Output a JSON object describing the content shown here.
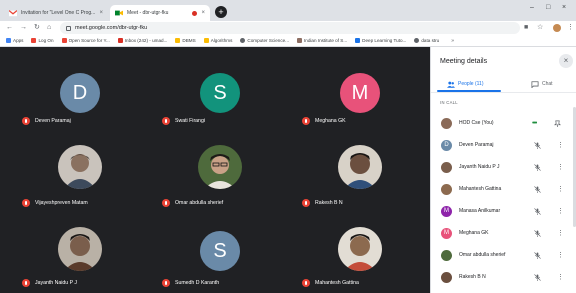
{
  "browser": {
    "tabs": [
      {
        "title": "Invitation for \"Level One C Prog...",
        "active": false,
        "favicon": "gmail-icon"
      },
      {
        "title": "Meet - dbr-utgr-fku",
        "active": true,
        "favicon": "meet-icon",
        "recording": true
      }
    ],
    "url": "meet.google.com/dbr-utgr-fku",
    "bookmarks": [
      {
        "label": "Apps",
        "color": "#4285f4"
      },
      {
        "label": "Log On",
        "color": "#ea4335"
      },
      {
        "label": "Open Source for Y...",
        "color": "#ea4335"
      },
      {
        "label": "Inbox (242) - umad...",
        "color": "#d93025"
      },
      {
        "label": "DBMS",
        "color": "#fbbc04"
      },
      {
        "label": "Algorithms",
        "color": "#fbbc04"
      },
      {
        "label": "Computer Science...",
        "color": "#5f6368"
      },
      {
        "label": "Indian Institute of S...",
        "color": "#8d6e63"
      },
      {
        "label": "Deep Learning Tuto...",
        "color": "#1a73e8"
      },
      {
        "label": "data stru",
        "color": "#5f6368"
      }
    ]
  },
  "stage": {
    "tiles": [
      {
        "name": "Deven Paramaj",
        "type": "initial",
        "initial": "D",
        "color": "#6a8aa8"
      },
      {
        "name": "Swati Firangi",
        "type": "initial",
        "initial": "S",
        "color": "#12937c"
      },
      {
        "name": "Meghana GK",
        "type": "initial",
        "initial": "M",
        "color": "#e8527a"
      },
      {
        "name": "Vijayeshpreven Matam",
        "type": "photo",
        "color": "#8a7160"
      },
      {
        "name": "Omar abdulla sherief",
        "type": "photo",
        "color": "#4e6a3c"
      },
      {
        "name": "Rakesh B N",
        "type": "photo",
        "color": "#6b4f3f"
      },
      {
        "name": "Jayanth Naidu P J",
        "type": "photo",
        "color": "#7a5e4c"
      },
      {
        "name": "Sumedh D Karanth",
        "type": "initial",
        "initial": "S",
        "color": "#6a8aa8"
      },
      {
        "name": "Mahantesh Gattina",
        "type": "photo",
        "color": "#8c6a4f"
      }
    ]
  },
  "panel": {
    "title": "Meeting details",
    "tab_people": "People (11)",
    "tab_chat": "Chat",
    "section": "IN CALL",
    "participants": [
      {
        "name": "HOD Cse (You)",
        "avatar": "photo",
        "color": "#8a6a58",
        "you": true
      },
      {
        "name": "Deven Paramaj",
        "avatar": "initial",
        "initial": "D",
        "color": "#6a8aa8"
      },
      {
        "name": "Jayanth Naidu P J",
        "avatar": "photo",
        "color": "#7a5e4c"
      },
      {
        "name": "Mahantesh Gattina",
        "avatar": "photo",
        "color": "#8c6a4f"
      },
      {
        "name": "Manasa Anilkumar",
        "avatar": "initial",
        "initial": "M",
        "color": "#8e24aa"
      },
      {
        "name": "Meghana GK",
        "avatar": "initial",
        "initial": "M",
        "color": "#e8527a"
      },
      {
        "name": "Omar abdulla sherief",
        "avatar": "photo",
        "color": "#4e6a3c"
      },
      {
        "name": "Rakesh B N",
        "avatar": "photo",
        "color": "#6b4f3f"
      }
    ]
  }
}
